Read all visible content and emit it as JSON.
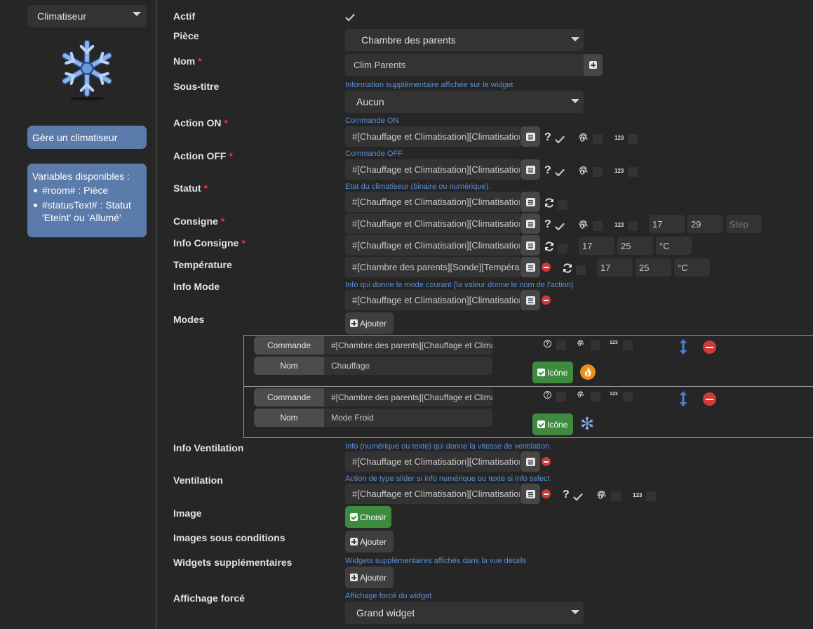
{
  "sidebar": {
    "type_select": "Climatiseur",
    "icon": "snowflake-icon",
    "description": "Gère un climatiseur",
    "vars_title": "Variables disponibles :",
    "vars": [
      "#room# : Pièce",
      "#statusText# : Statut 'Eteint' ou 'Allumé'"
    ]
  },
  "form": {
    "actif": {
      "label": "Actif",
      "checked": true
    },
    "piece": {
      "label": "Pièce",
      "value": "Chambre des parents"
    },
    "nom": {
      "label": "Nom",
      "required": "*",
      "value": "Clim Parents"
    },
    "sous_titre": {
      "label": "Sous-titre",
      "help": "Information supplémentaire affichée sur le widget",
      "value": "Aucun"
    },
    "action_on": {
      "label": "Action ON",
      "required": "*",
      "help": "Commande ON",
      "value": "#[Chauffage et Climatisation][Climatisation]"
    },
    "action_off": {
      "label": "Action OFF",
      "required": "*",
      "help": "Commande OFF",
      "value": "#[Chauffage et Climatisation][Climatisation]"
    },
    "statut": {
      "label": "Statut",
      "required": "*",
      "help": "Etat du climatiseur (binaire ou numérique).",
      "value": "#[Chauffage et Climatisation][Climatisation]"
    },
    "consigne": {
      "label": "Consigne",
      "required": "*",
      "value": "#[Chauffage et Climatisation][Climatisation]",
      "min": "17",
      "max": "29",
      "step_placeholder": "Step"
    },
    "info_consigne": {
      "label": "Info Consigne",
      "required": "*",
      "value": "#[Chauffage et Climatisation][Climatisation]",
      "min": "17",
      "max": "25",
      "unit": "°C"
    },
    "temperature": {
      "label": "Température",
      "value": "#[Chambre des parents][Sonde][Température]",
      "min": "17",
      "max": "25",
      "unit": "°C"
    },
    "info_mode": {
      "label": "Info Mode",
      "help": "Info qui donne le mode courant (la valeur donne le nom de l'action)",
      "value": "#[Chauffage et Climatisation][Climatisation]"
    },
    "modes": {
      "label": "Modes",
      "add_label": "Ajouter",
      "items": [
        {
          "cmd_label": "Commande",
          "cmd_value": "#[Chambre des parents][Chauffage et Climatisation]",
          "name_label": "Nom",
          "name_value": "Chauffage",
          "icon_button": "Icône",
          "icon": "flame-icon"
        },
        {
          "cmd_label": "Commande",
          "cmd_value": "#[Chambre des parents][Chauffage et Climatisation]",
          "name_label": "Nom",
          "name_value": "Mode Froid",
          "icon_button": "Icône",
          "icon": "snowflake-icon"
        }
      ]
    },
    "info_ventilation": {
      "label": "Info Ventilation",
      "help": "Info (numérique ou texte) qui donne la vitesse de ventilation",
      "value": "#[Chauffage et Climatisation][Climatisation]"
    },
    "ventilation": {
      "label": "Ventilation",
      "help": "Action de type slider si info numérique ou texte si info select",
      "value": "#[Chauffage et Climatisation][Climatisation]"
    },
    "image": {
      "label": "Image",
      "button": "Choisir"
    },
    "images_conditions": {
      "label": "Images sous conditions",
      "add_label": "Ajouter"
    },
    "widgets_supp": {
      "label": "Widgets supplémentaires",
      "help": "Widgets supplémentaires affichés dans la vue détails",
      "add_label": "Ajouter"
    },
    "affichage_force": {
      "label": "Affichage forcé",
      "help": "Affichage forcé du widget",
      "value": "Grand widget"
    }
  },
  "glyphs": {
    "question": "?",
    "n123": "123"
  },
  "colors": {
    "accent_blue": "#5b7bab",
    "green": "#3e8a3e",
    "danger": "#d13a3a",
    "help_text": "#5a8fd6",
    "required": "#e53434"
  }
}
